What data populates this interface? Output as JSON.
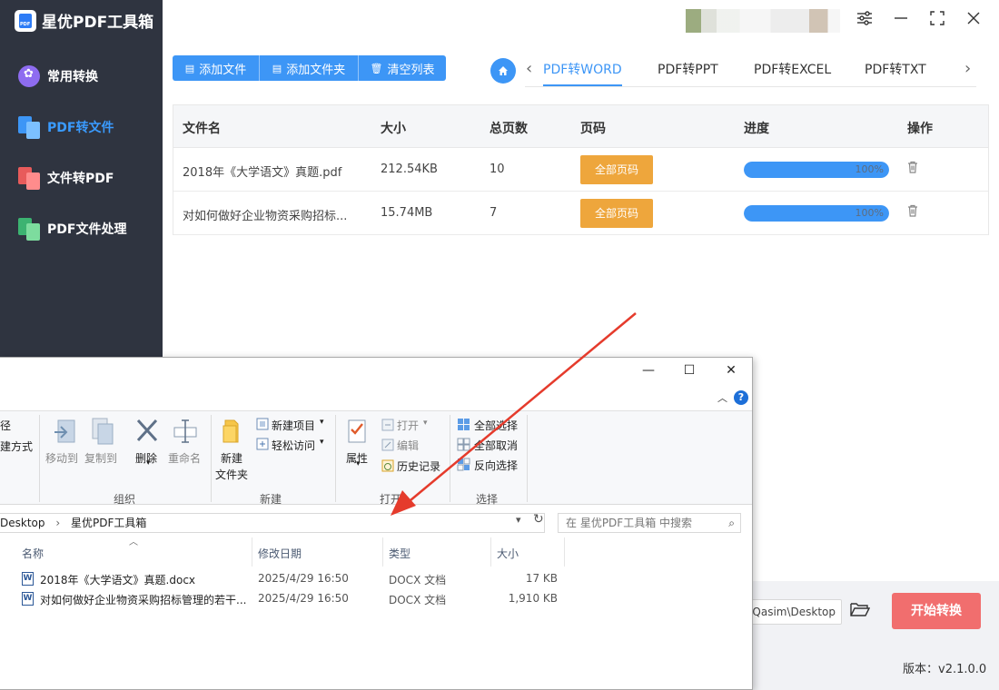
{
  "app": {
    "title": "星优PDF工具箱",
    "logo_text": "PDF"
  },
  "sidebar": {
    "items": [
      {
        "label": "常用转换",
        "icon": "flower-icon"
      },
      {
        "label": "PDF转文件",
        "icon": "pdf-to-file-icon"
      },
      {
        "label": "文件转PDF",
        "icon": "file-to-pdf-icon"
      },
      {
        "label": "PDF文件处理",
        "icon": "pdf-process-icon"
      }
    ],
    "active_index": 1
  },
  "toolbar": {
    "add_file": "添加文件",
    "add_folder": "添加文件夹",
    "clear_list": "清空列表"
  },
  "tabs": [
    "PDF转WORD",
    "PDF转PPT",
    "PDF转EXCEL",
    "PDF转TXT"
  ],
  "table": {
    "headers": [
      "文件名",
      "大小",
      "总页数",
      "页码",
      "进度",
      "操作"
    ],
    "rows": [
      {
        "name": "2018年《大学语文》真题.pdf",
        "size": "212.54KB",
        "pages": "10",
        "page_btn": "全部页码",
        "progress": "100%",
        "progress_value": 1.0
      },
      {
        "name": "对如何做好企业物资采购招标...",
        "size": "15.74MB",
        "pages": "7",
        "page_btn": "全部页码",
        "progress": "100%",
        "progress_value": 1.0
      }
    ]
  },
  "output": {
    "path": "Qasim\\Desktop'",
    "start_button": "开始转换",
    "version": "版本：v2.1.0.0"
  },
  "explorer": {
    "ribbon_left_partial": [
      "径",
      "建方式"
    ],
    "organize": {
      "move_to": "移动到",
      "copy_to": "复制到",
      "delete": "删除",
      "rename": "重命名",
      "label": "组织"
    },
    "new": {
      "new_folder_line1": "新建",
      "new_folder_line2": "文件夹",
      "new_item": "新建项目",
      "easy_access": "轻松访问",
      "label": "新建"
    },
    "open": {
      "properties": "属性",
      "open": "打开",
      "edit": "编辑",
      "history": "历史记录",
      "label": "打开"
    },
    "select": {
      "select_all": "全部选择",
      "select_none": "全部取消",
      "invert": "反向选择",
      "label": "选择"
    },
    "address": {
      "crumb1": "Desktop",
      "sep": "›",
      "crumb2": "星优PDF工具箱"
    },
    "search_placeholder": "在 星优PDF工具箱 中搜索",
    "columns": [
      "名称",
      "修改日期",
      "类型",
      "大小"
    ],
    "files": [
      {
        "name": "2018年《大学语文》真题.docx",
        "date": "2025/4/29 16:50",
        "type": "DOCX 文档",
        "size": "17 KB"
      },
      {
        "name": "对如何做好企业物资采购招标管理的若干...",
        "date": "2025/4/29 16:50",
        "type": "DOCX 文档",
        "size": "1,910 KB"
      }
    ]
  },
  "colors": {
    "sidebar_bg": "#2f3440",
    "accent": "#3d96f6",
    "page_btn": "#eea63c",
    "start_btn": "#f16e6e",
    "arrow": "#e53b2c"
  }
}
